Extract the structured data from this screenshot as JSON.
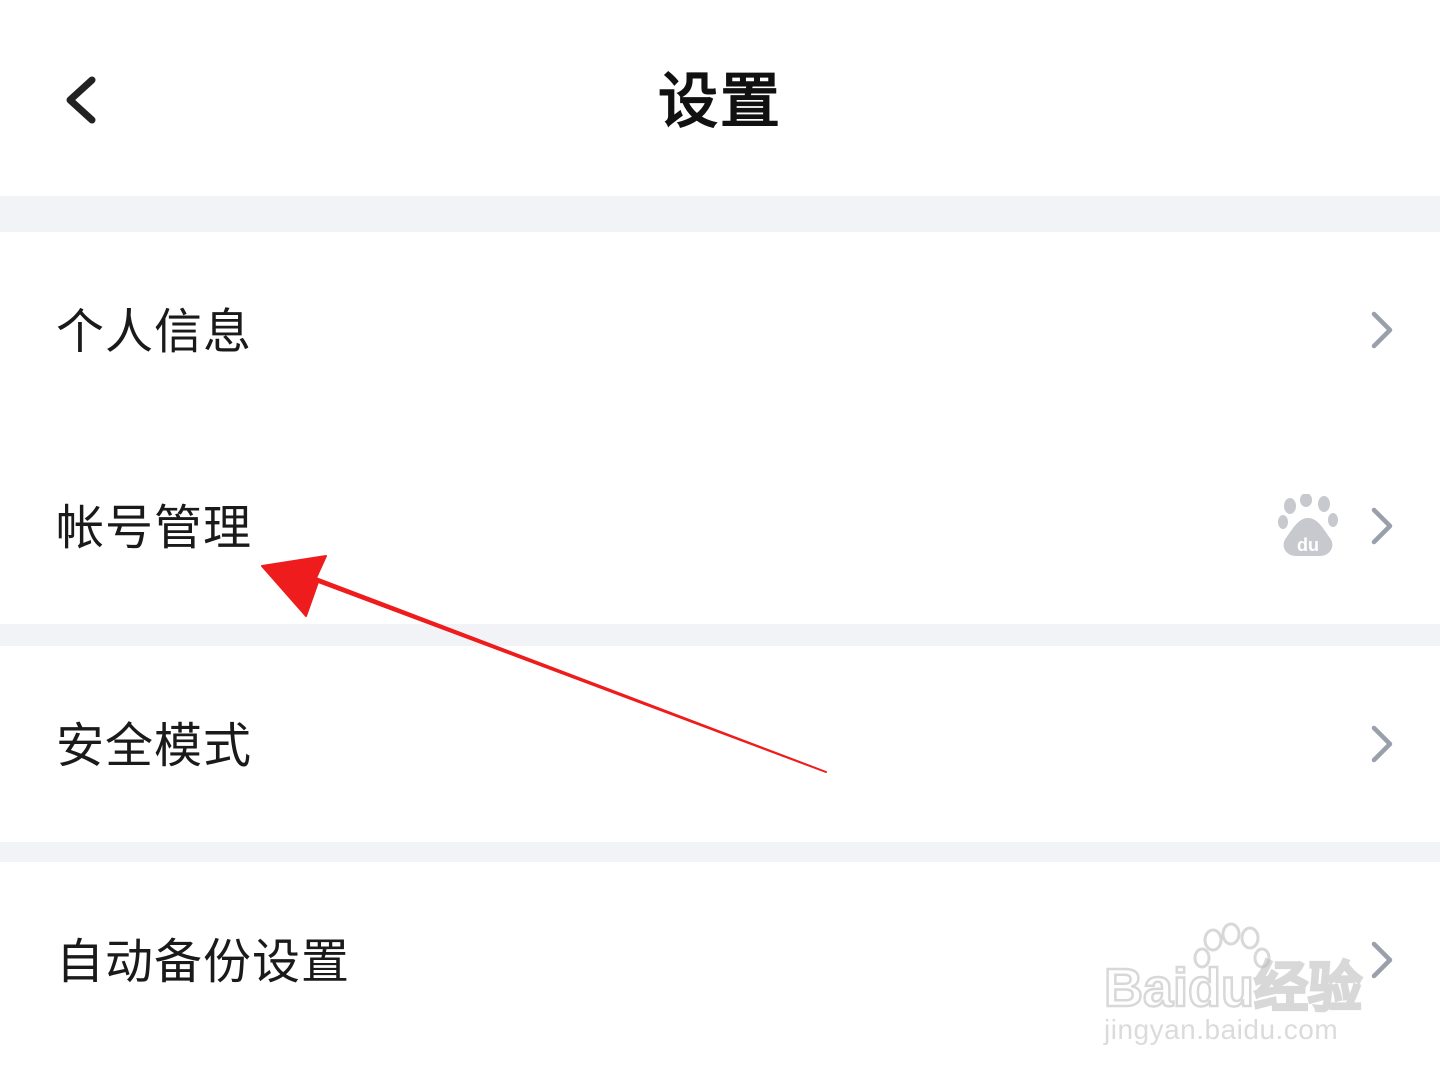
{
  "header": {
    "title": "设置",
    "back_icon": "chevron-left-icon"
  },
  "settings": {
    "items": [
      {
        "label": "个人信息",
        "chevron_icon": "chevron-right-icon"
      },
      {
        "label": "帐号管理",
        "chevron_icon": "chevron-right-icon",
        "badge_icon": "baidu-paw-icon"
      },
      {
        "label": "安全模式",
        "chevron_icon": "chevron-right-icon"
      },
      {
        "label": "自动备份设置",
        "chevron_icon": "chevron-right-icon"
      }
    ]
  },
  "annotation": {
    "arrow_color": "#ee1c1c"
  },
  "watermark": {
    "brand": "Baidu经验",
    "url": "jingyan.baidu.com"
  },
  "colors": {
    "separator": "#f2f3f7",
    "chevron": "#9aa0ab",
    "baidu_logo": "#c7c9cf"
  }
}
